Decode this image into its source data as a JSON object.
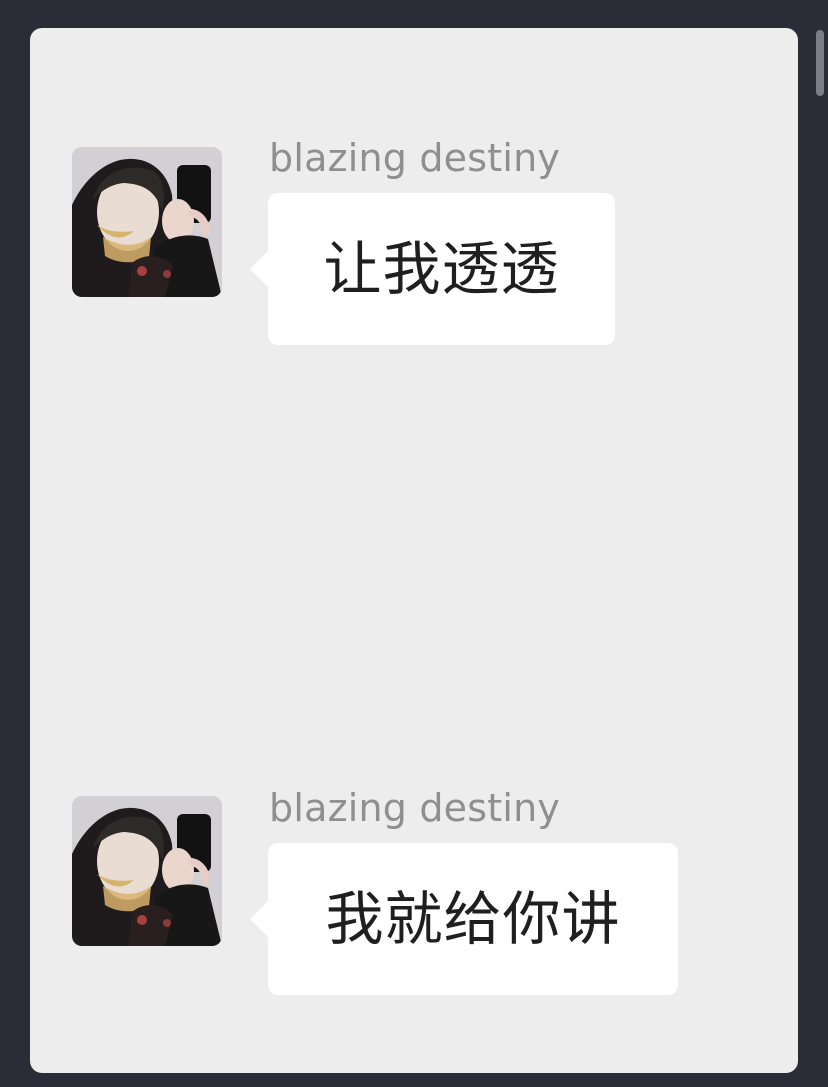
{
  "chat": {
    "messages": [
      {
        "sender": "blazing destiny",
        "text": "让我透透",
        "avatar_icon": "user-avatar-photo"
      },
      {
        "sender": "blazing destiny",
        "text": "我就给你讲",
        "avatar_icon": "user-avatar-photo"
      }
    ]
  },
  "colors": {
    "outer_background": "#2b2c38",
    "chat_background": "#ededed",
    "bubble_background": "#ffffff",
    "sender_text": "#8f8f8f",
    "message_text": "#1f1f1f"
  }
}
